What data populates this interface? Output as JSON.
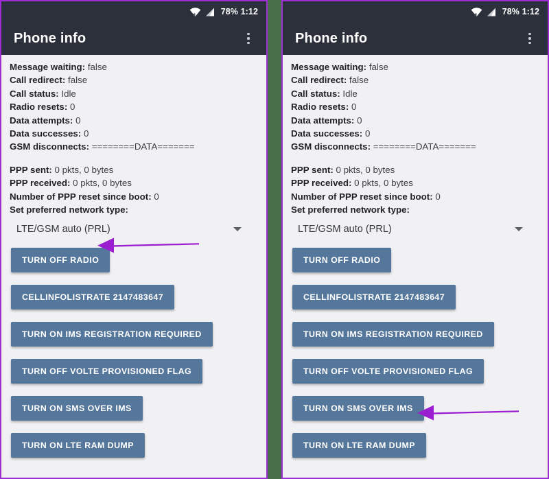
{
  "statusbar": {
    "wifi_icon": "wifi-icon",
    "signal_icon": "cell-signal-icon",
    "battery_percent": "78%",
    "clock": "1:12",
    "status_text": "78% 1:12"
  },
  "appbar": {
    "title": "Phone info",
    "overflow_icon": "overflow-menu-icon"
  },
  "info": {
    "group1": [
      {
        "key": "Message waiting:",
        "value": "false"
      },
      {
        "key": "Call redirect:",
        "value": "false"
      },
      {
        "key": "Call status:",
        "value": "Idle"
      },
      {
        "key": "Radio resets:",
        "value": "0"
      },
      {
        "key": "Data attempts:",
        "value": "0"
      },
      {
        "key": "Data successes:",
        "value": "0"
      },
      {
        "key": "GSM disconnects:",
        "value": "========DATA======="
      }
    ],
    "group2": [
      {
        "key": "PPP sent:",
        "value": "0 pkts, 0 bytes"
      },
      {
        "key": "PPP received:",
        "value": "0 pkts, 0 bytes"
      },
      {
        "key": "Number of PPP reset since boot:",
        "value": "0"
      },
      {
        "key": "Set preferred network type:",
        "value": ""
      }
    ]
  },
  "spinner": {
    "label": "Set preferred network type:",
    "selected": "LTE/GSM auto (PRL)",
    "caret_icon": "chevron-down-icon"
  },
  "buttons": [
    "TURN OFF RADIO",
    "CELLINFOLISTRATE 2147483647",
    "TURN ON IMS REGISTRATION REQUIRED",
    "TURN OFF VOLTE PROVISIONED FLAG",
    "TURN ON SMS OVER IMS",
    "TURN ON LTE RAM DUMP"
  ],
  "annotations": {
    "left_arrow_target": "TURN OFF RADIO",
    "right_arrow_target": "TURN ON SMS OVER IMS",
    "arrow_color": "#9b1fd0"
  },
  "colors": {
    "appbar_bg": "#2b303b",
    "content_bg": "#f1f1f3",
    "button_bg": "#56779c",
    "panel_border": "#9b2fd4",
    "divider": "#47704a",
    "arrow": "#9b1fd0"
  }
}
